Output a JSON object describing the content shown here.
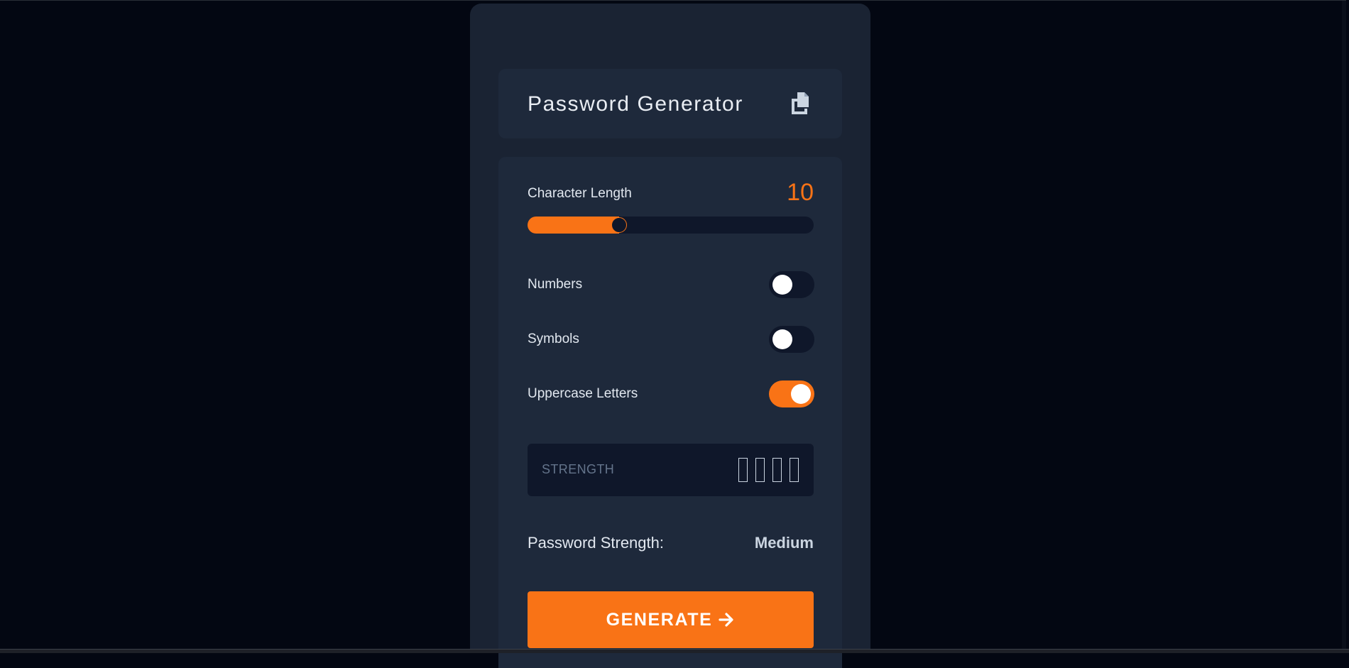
{
  "app": {
    "title": "Password Generator"
  },
  "settings": {
    "length_label": "Character Length",
    "length_value": "10",
    "length_fraction": 0.32,
    "options": [
      {
        "label": "Numbers",
        "enabled": false
      },
      {
        "label": "Symbols",
        "enabled": false
      },
      {
        "label": "Uppercase Letters",
        "enabled": true
      }
    ]
  },
  "strength": {
    "box_label": "STRENGTH",
    "filled_bars": 0,
    "total_bars": 4,
    "summary_label": "Password Strength:",
    "summary_value": "Medium"
  },
  "actions": {
    "generate_label": "GENERATE"
  },
  "icons": {
    "copy": "copy-icon",
    "arrow": "arrow-right-icon"
  },
  "colors": {
    "accent": "#f97316",
    "background": "#030712",
    "panel": "#1a2333",
    "card": "#1e293b",
    "track": "#0f172a"
  }
}
